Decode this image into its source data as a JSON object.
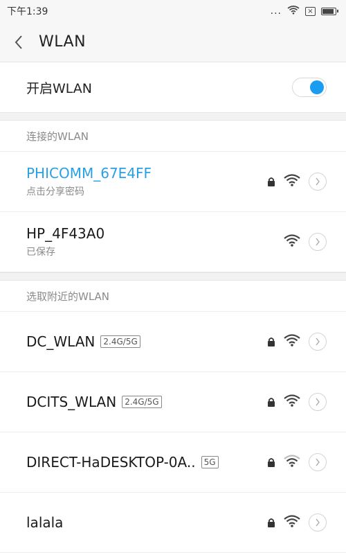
{
  "status_bar": {
    "time": "下午1:39",
    "dots": "..."
  },
  "header": {
    "title": "WLAN"
  },
  "toggle": {
    "label": "开启WLAN",
    "on": true,
    "accent": "#1a9df0"
  },
  "connected_section": {
    "title": "连接的WLAN",
    "networks": [
      {
        "ssid": "PHICOMM_67E4FF",
        "subtitle": "点击分享密码",
        "locked": true
      },
      {
        "ssid": "HP_4F43A0",
        "subtitle": "已保存",
        "locked": false
      }
    ]
  },
  "nearby_section": {
    "title": "选取附近的WLAN",
    "networks": [
      {
        "ssid": "DC_WLAN",
        "band": "2.4G/5G",
        "locked": true
      },
      {
        "ssid": "DCITS_WLAN",
        "band": "2.4G/5G",
        "locked": true
      },
      {
        "ssid": "DIRECT-HaDESKTOP-0A..",
        "band": "5G",
        "locked": true
      },
      {
        "ssid": "lalala",
        "band": "",
        "locked": true
      }
    ]
  },
  "colors": {
    "connected_ssid": "#27a0e6",
    "section_text": "#8a8a8a"
  }
}
